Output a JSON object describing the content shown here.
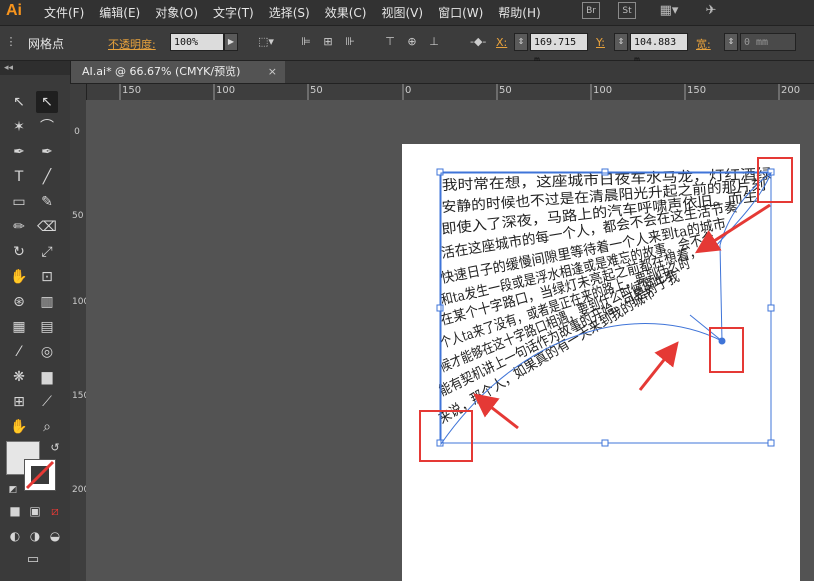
{
  "app": {
    "logo": "Ai"
  },
  "menu": [
    "文件(F)",
    "编辑(E)",
    "对象(O)",
    "文字(T)",
    "选择(S)",
    "效果(C)",
    "视图(V)",
    "窗口(W)",
    "帮助(H)"
  ],
  "menubar_icons": {
    "br": "Br",
    "st": "St"
  },
  "control": {
    "selection_label": "网格点",
    "opacity_label": "不透明度:",
    "opacity_value": "100%",
    "x_label": "X:",
    "x_value": "169.715 m",
    "y_label": "Y:",
    "y_value": "104.883 m",
    "w_label": "宽:",
    "w_value": "0 mm"
  },
  "tab": {
    "title": "AI.ai* @ 66.67% (CMYK/预览)",
    "close": "×"
  },
  "ruler_h": [
    "150",
    "100",
    "50",
    "0",
    "50",
    "100",
    "150",
    "200"
  ],
  "ruler_v": [
    "0",
    "50",
    "100",
    "150",
    "200"
  ],
  "text_lines": [
    "我时常在想，这座城市日夜车水马龙，灯红酒绿",
    "安静的时候也不过是在清晨阳光升起之前的那片刻",
    "即使入了深夜，马路上的汽车呼啸声依旧。而生",
    "活在这座城市的每一个人，都会不会在这生活节奏",
    "快速日子的缓慢间隙里等待着一个人来到ta的城市",
    "和ta发生一段或是浮水相逢或是难忘的故事。会不会",
    "在某个十字路口，当绿灯未亮起之前都在想着，",
    "个人ta来了没有，或者是正在来的路上，要到什么时",
    "候才能够在这十字路口相遇，要到什么时候彼此才",
    "能有契机讲上一句话作为故事的开始。可是对于我",
    "来说，那个人，如果真的有一天来到我的城市"
  ],
  "colors": {
    "accent": "#e8a23c",
    "selection": "#3f74d8",
    "highlight": "#e53935"
  }
}
